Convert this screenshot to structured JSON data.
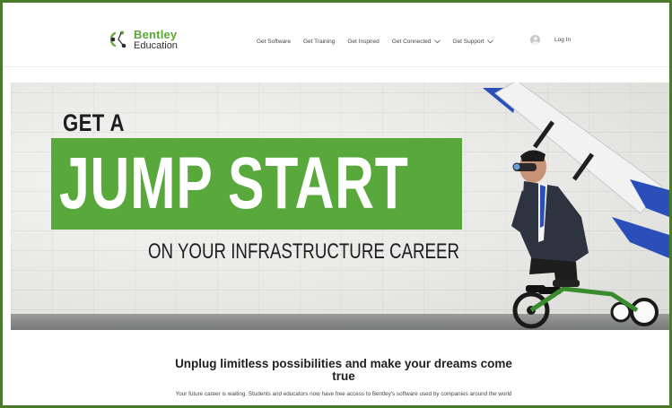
{
  "brand": {
    "name": "Bentley",
    "product": "Education",
    "accent_color": "#58a83b",
    "logo_icon": "bentley-logo-icon"
  },
  "nav": {
    "items": [
      {
        "label": "Get Software",
        "has_dropdown": false
      },
      {
        "label": "Get Training",
        "has_dropdown": false
      },
      {
        "label": "Get Inspired",
        "has_dropdown": false
      },
      {
        "label": "Get Connected",
        "has_dropdown": true
      },
      {
        "label": "Get Support",
        "has_dropdown": true
      }
    ],
    "user_icon": "user-icon",
    "login_label": "Log In"
  },
  "hero": {
    "line1": "GET A",
    "line2": "JUMP START",
    "line3": "ON YOUR INFRASTRUCTURE CAREER",
    "highlight_color": "#58a83b"
  },
  "content": {
    "tagline": "Unplug limitless possibilities and make your dreams come true",
    "description": "Your future career is waiting. Students and educators now have free access to Bentley's software used by companies around the world"
  }
}
